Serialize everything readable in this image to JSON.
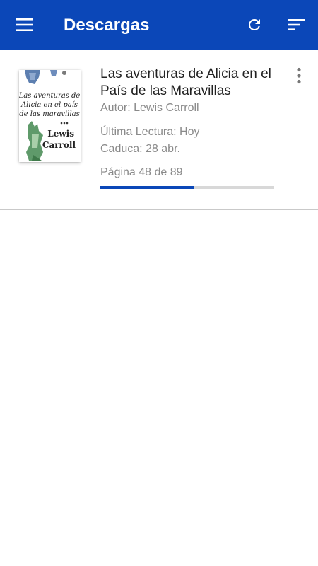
{
  "appbar": {
    "title": "Descargas",
    "color": "#0b47b8",
    "icons": [
      "menu-icon",
      "refresh-icon",
      "sort-icon"
    ]
  },
  "books": [
    {
      "title": "Las aventuras de Alicia en el País de las Maravillas",
      "author": "Autor: Lewis Carroll",
      "last_read": "Última Lectura: Hoy",
      "expires": "Caduca: 28 abr.",
      "page_info": "Página 48 de 89",
      "progress": 0.539,
      "cover": {
        "title_lines": [
          "Las aventuras de",
          "Alicia en el país",
          "de las maravillas"
        ],
        "author_lines": [
          "Lewis",
          "Carroll"
        ]
      }
    }
  ]
}
